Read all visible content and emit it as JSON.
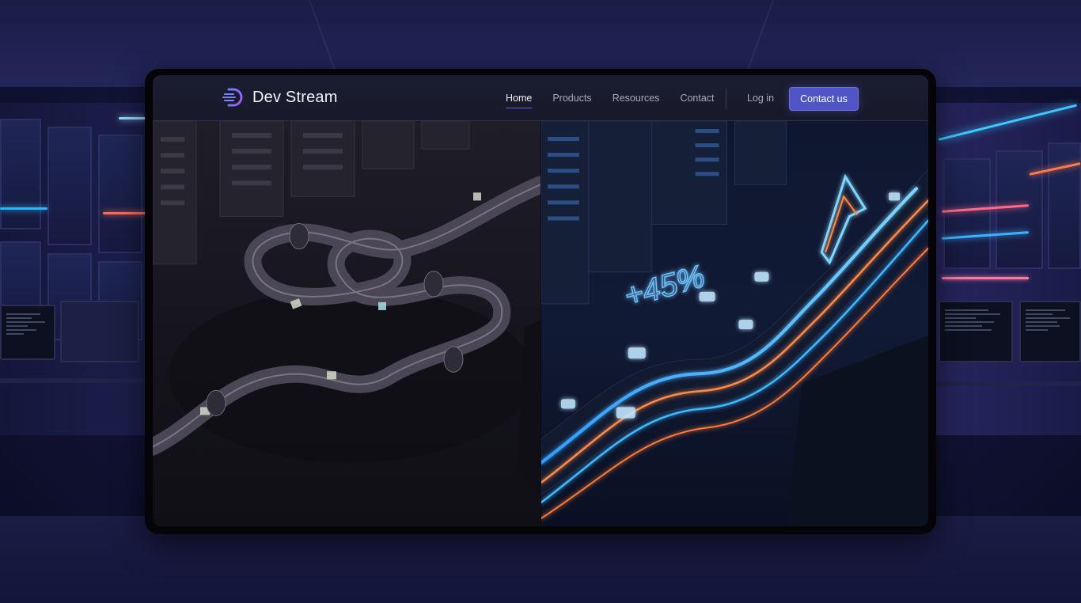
{
  "brand": {
    "name": "Dev Stream",
    "accent": "#4f55c4"
  },
  "nav": {
    "links": [
      {
        "label": "Home",
        "active": true
      },
      {
        "label": "Produсts",
        "active": false
      },
      {
        "label": "Resources",
        "active": false
      },
      {
        "label": "Contact",
        "active": false
      }
    ],
    "login_label": "Log in",
    "cta_label": "Contact us"
  },
  "hero": {
    "left_image": "tangled-pipeline-icon",
    "right_image": "streamlined-pipeline-arrow-icon",
    "growth_label": "+45%"
  }
}
